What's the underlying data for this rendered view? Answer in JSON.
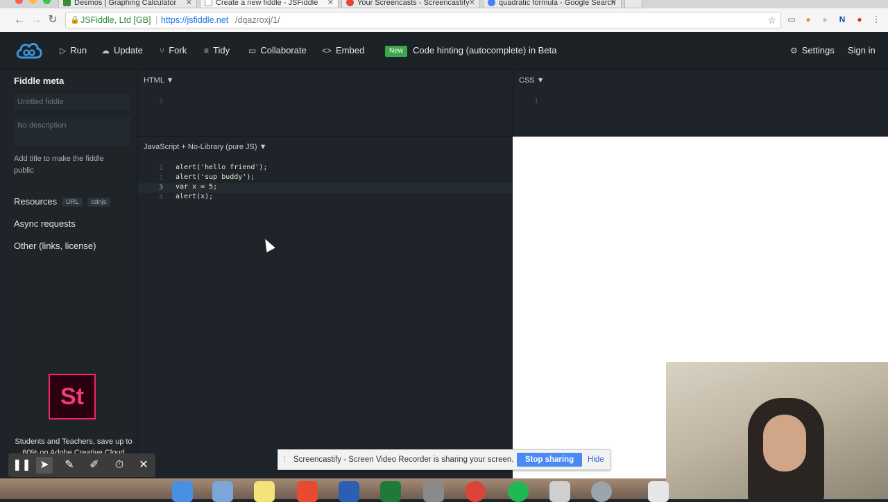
{
  "browser": {
    "tabs": [
      {
        "title": "Desmos | Graphing Calculator",
        "favicon_color": "#3a8a3a"
      },
      {
        "title": "Create a new fiddle - JSFiddle",
        "favicon_color": "#ffffff"
      },
      {
        "title": "Your Screencasts - Screencastify",
        "favicon_color": "#e0443a"
      },
      {
        "title": "quadratic formula - Google Search",
        "favicon_color": "#4285f4"
      }
    ],
    "address": {
      "secure_label": "JSFiddle, Ltd [GB]",
      "url_host": "https://jsfiddle.net",
      "url_path": "/dqazroxj/1/"
    }
  },
  "header": {
    "run": "Run",
    "update": "Update",
    "fork": "Fork",
    "tidy": "Tidy",
    "collaborate": "Collaborate",
    "embed": "Embed",
    "new_badge": "New",
    "announcement": "Code hinting (autocomplete) in Beta",
    "settings": "Settings",
    "sign_in": "Sign in"
  },
  "sidebar": {
    "title": "Fiddle meta",
    "title_placeholder": "Untitled fiddle",
    "description_placeholder": "No description",
    "hint": "Add title to make the fiddle public",
    "resources": "Resources",
    "resources_pills": [
      "URL",
      "cdnjs"
    ],
    "async": "Async requests",
    "other": "Other (links, license)",
    "ad": {
      "logo": "St",
      "text": "Students and Teachers, save up to 60% on Adobe Creative Cloud"
    }
  },
  "panels": {
    "html": {
      "label": "HTML ▼",
      "lines": [
        "1"
      ]
    },
    "css": {
      "label": "CSS ▼",
      "lines": [
        "1"
      ]
    },
    "js": {
      "label": "JavaScript + No-Library (pure JS) ▼",
      "lines": [
        {
          "num": "1",
          "code": "alert('hello friend');"
        },
        {
          "num": "2",
          "code": "alert('sup buddy');"
        },
        {
          "num": "3",
          "code": "var x = 5;"
        },
        {
          "num": "4",
          "code": "alert(x);"
        }
      ]
    }
  },
  "screencastify": {
    "message": "Screencastify - Screen Video Recorder is sharing your screen.",
    "stop": "Stop sharing",
    "hide": "Hide"
  },
  "recorder_tools": [
    "pause-icon",
    "pointer-icon",
    "pen-icon",
    "highlighter-icon",
    "timer-icon",
    "close-icon"
  ]
}
